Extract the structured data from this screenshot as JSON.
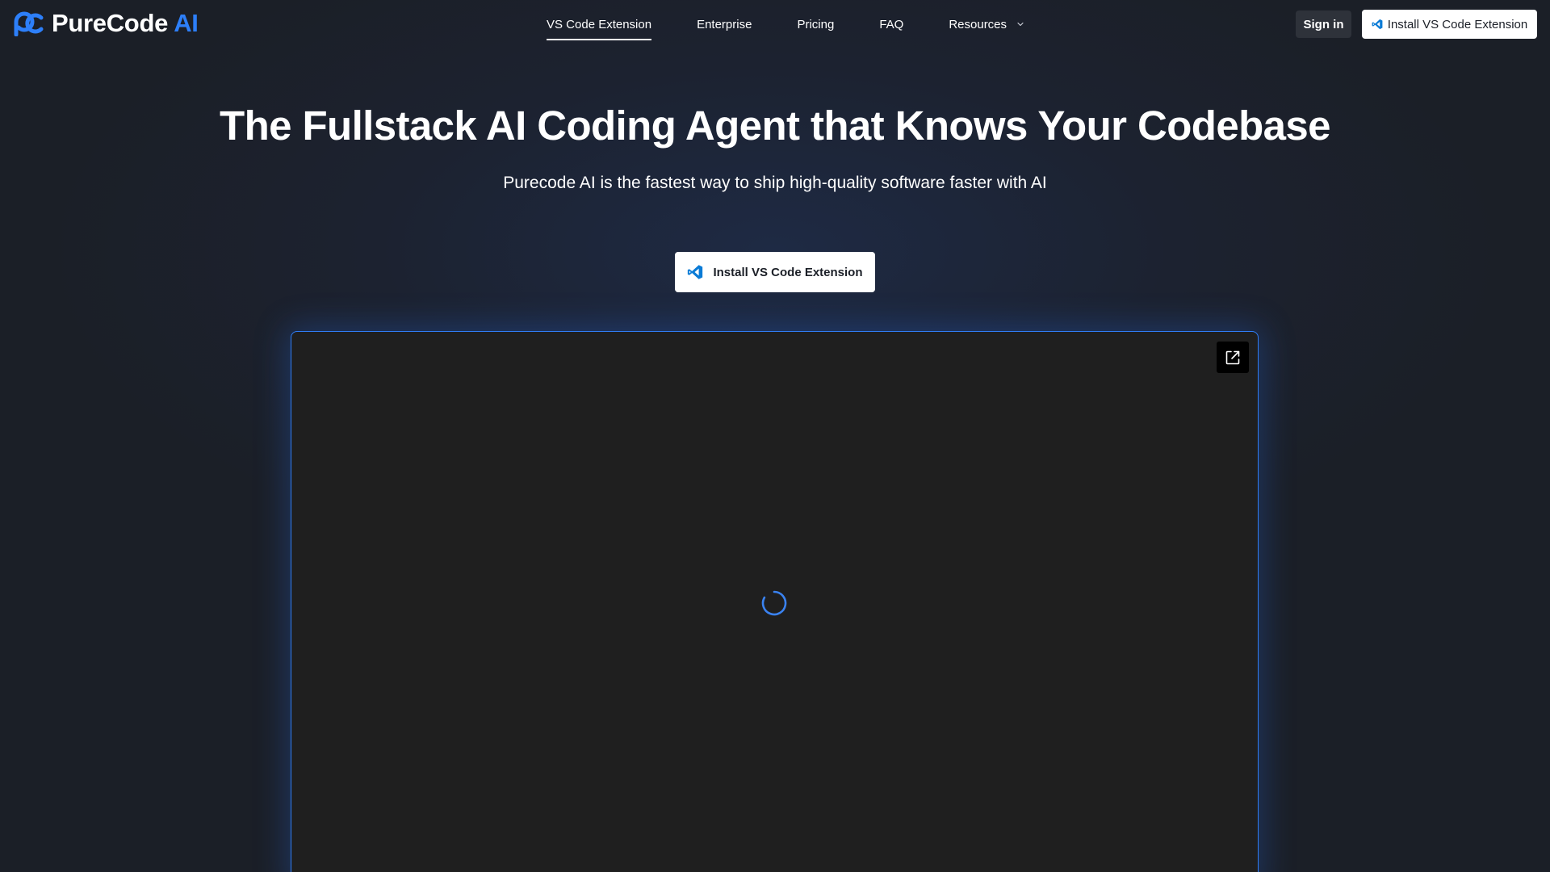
{
  "brand": {
    "name": "PureCode",
    "accent": "AI",
    "accent_color": "#2d7ff9"
  },
  "nav": {
    "items": [
      {
        "label": "VS Code Extension",
        "active": true
      },
      {
        "label": "Enterprise",
        "active": false
      },
      {
        "label": "Pricing",
        "active": false
      },
      {
        "label": "FAQ",
        "active": false
      },
      {
        "label": "Resources",
        "active": false,
        "icon": "chevron-down-icon"
      }
    ]
  },
  "header": {
    "signin_label": "Sign in",
    "install_label": "Install VS Code Extension",
    "install_icon": "vscode-icon"
  },
  "hero": {
    "title": "The Fullstack AI Coding Agent that Knows Your Codebase",
    "subtitle": "Purecode AI is the fastest way to ship high-quality software faster with AI",
    "cta_label": "Install VS Code Extension",
    "cta_icon": "vscode-icon"
  },
  "demo": {
    "expand_icon": "external-link-icon",
    "loading_icon": "spinner-icon",
    "frame_border_color": "#2f7df6"
  },
  "colors": {
    "background": "#1c2029",
    "button_bg": "#ffffff",
    "signin_bg": "#2e323a",
    "vscode_blue": "#0a7bd6"
  }
}
